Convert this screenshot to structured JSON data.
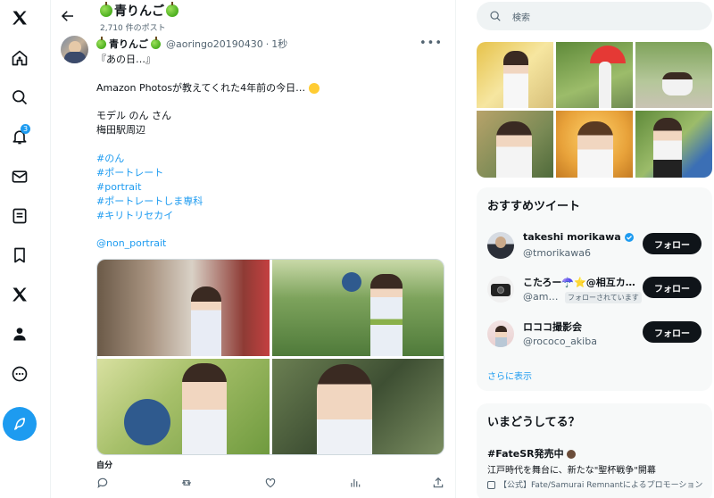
{
  "colors": {
    "accent": "#1d9bf0",
    "text": "#0f1419",
    "muted": "#536471",
    "card_bg": "#f7f9f9"
  },
  "nav": {
    "items": [
      "x-logo-icon",
      "home-icon",
      "explore-icon",
      "notifications-icon",
      "messages-icon",
      "lists-icon",
      "bookmarks-icon",
      "premium-icon",
      "profile-icon",
      "more-icon"
    ],
    "notifications_badge": "3",
    "post_button_icon": "feather-icon"
  },
  "header": {
    "title": "青りんご",
    "post_count": "2,710 件のポスト"
  },
  "tweet": {
    "display_name": "青りんご",
    "handle": "@aoringo20190430",
    "separator": "·",
    "time": "1秒",
    "lines": {
      "l1": "『あの日…』",
      "l2": "Amazon Photosが教えてくれた4年前の今日…",
      "l3": "モデル のん さん",
      "l4": "梅田駅周辺"
    },
    "hashtags": [
      "#のん",
      "#ポートレート",
      "#portrait",
      "#ポートレートしま専科",
      "#キリトリセカイ"
    ],
    "mention": "@non_portrait",
    "alt_label": "自分",
    "actions": [
      "reply-icon",
      "repost-icon",
      "like-icon",
      "views-icon",
      "share-icon"
    ]
  },
  "search": {
    "placeholder": "検索"
  },
  "recommend": {
    "title": "おすすめツイート",
    "users": [
      {
        "name": "takeshi morikawa",
        "handle": "@tmorikawa6",
        "verified": true,
        "button": "フォロー"
      },
      {
        "name": "こたろー☂️⭐️@相互カ…",
        "handle": "@am…",
        "follows_you": "フォローされています",
        "button": "フォロー"
      },
      {
        "name": "ロココ撮影会",
        "handle": "@rococo_akiba",
        "button": "フォロー"
      }
    ],
    "show_more": "さらに表示"
  },
  "trends": {
    "title": "いまどうしてる？",
    "tag": "#FateSR発売中",
    "desc": "江戸時代を舞台に、新たな\"聖杯戦争\"開幕",
    "promo": "【公式】Fate/Samurai Remnantによるプロモーション"
  }
}
